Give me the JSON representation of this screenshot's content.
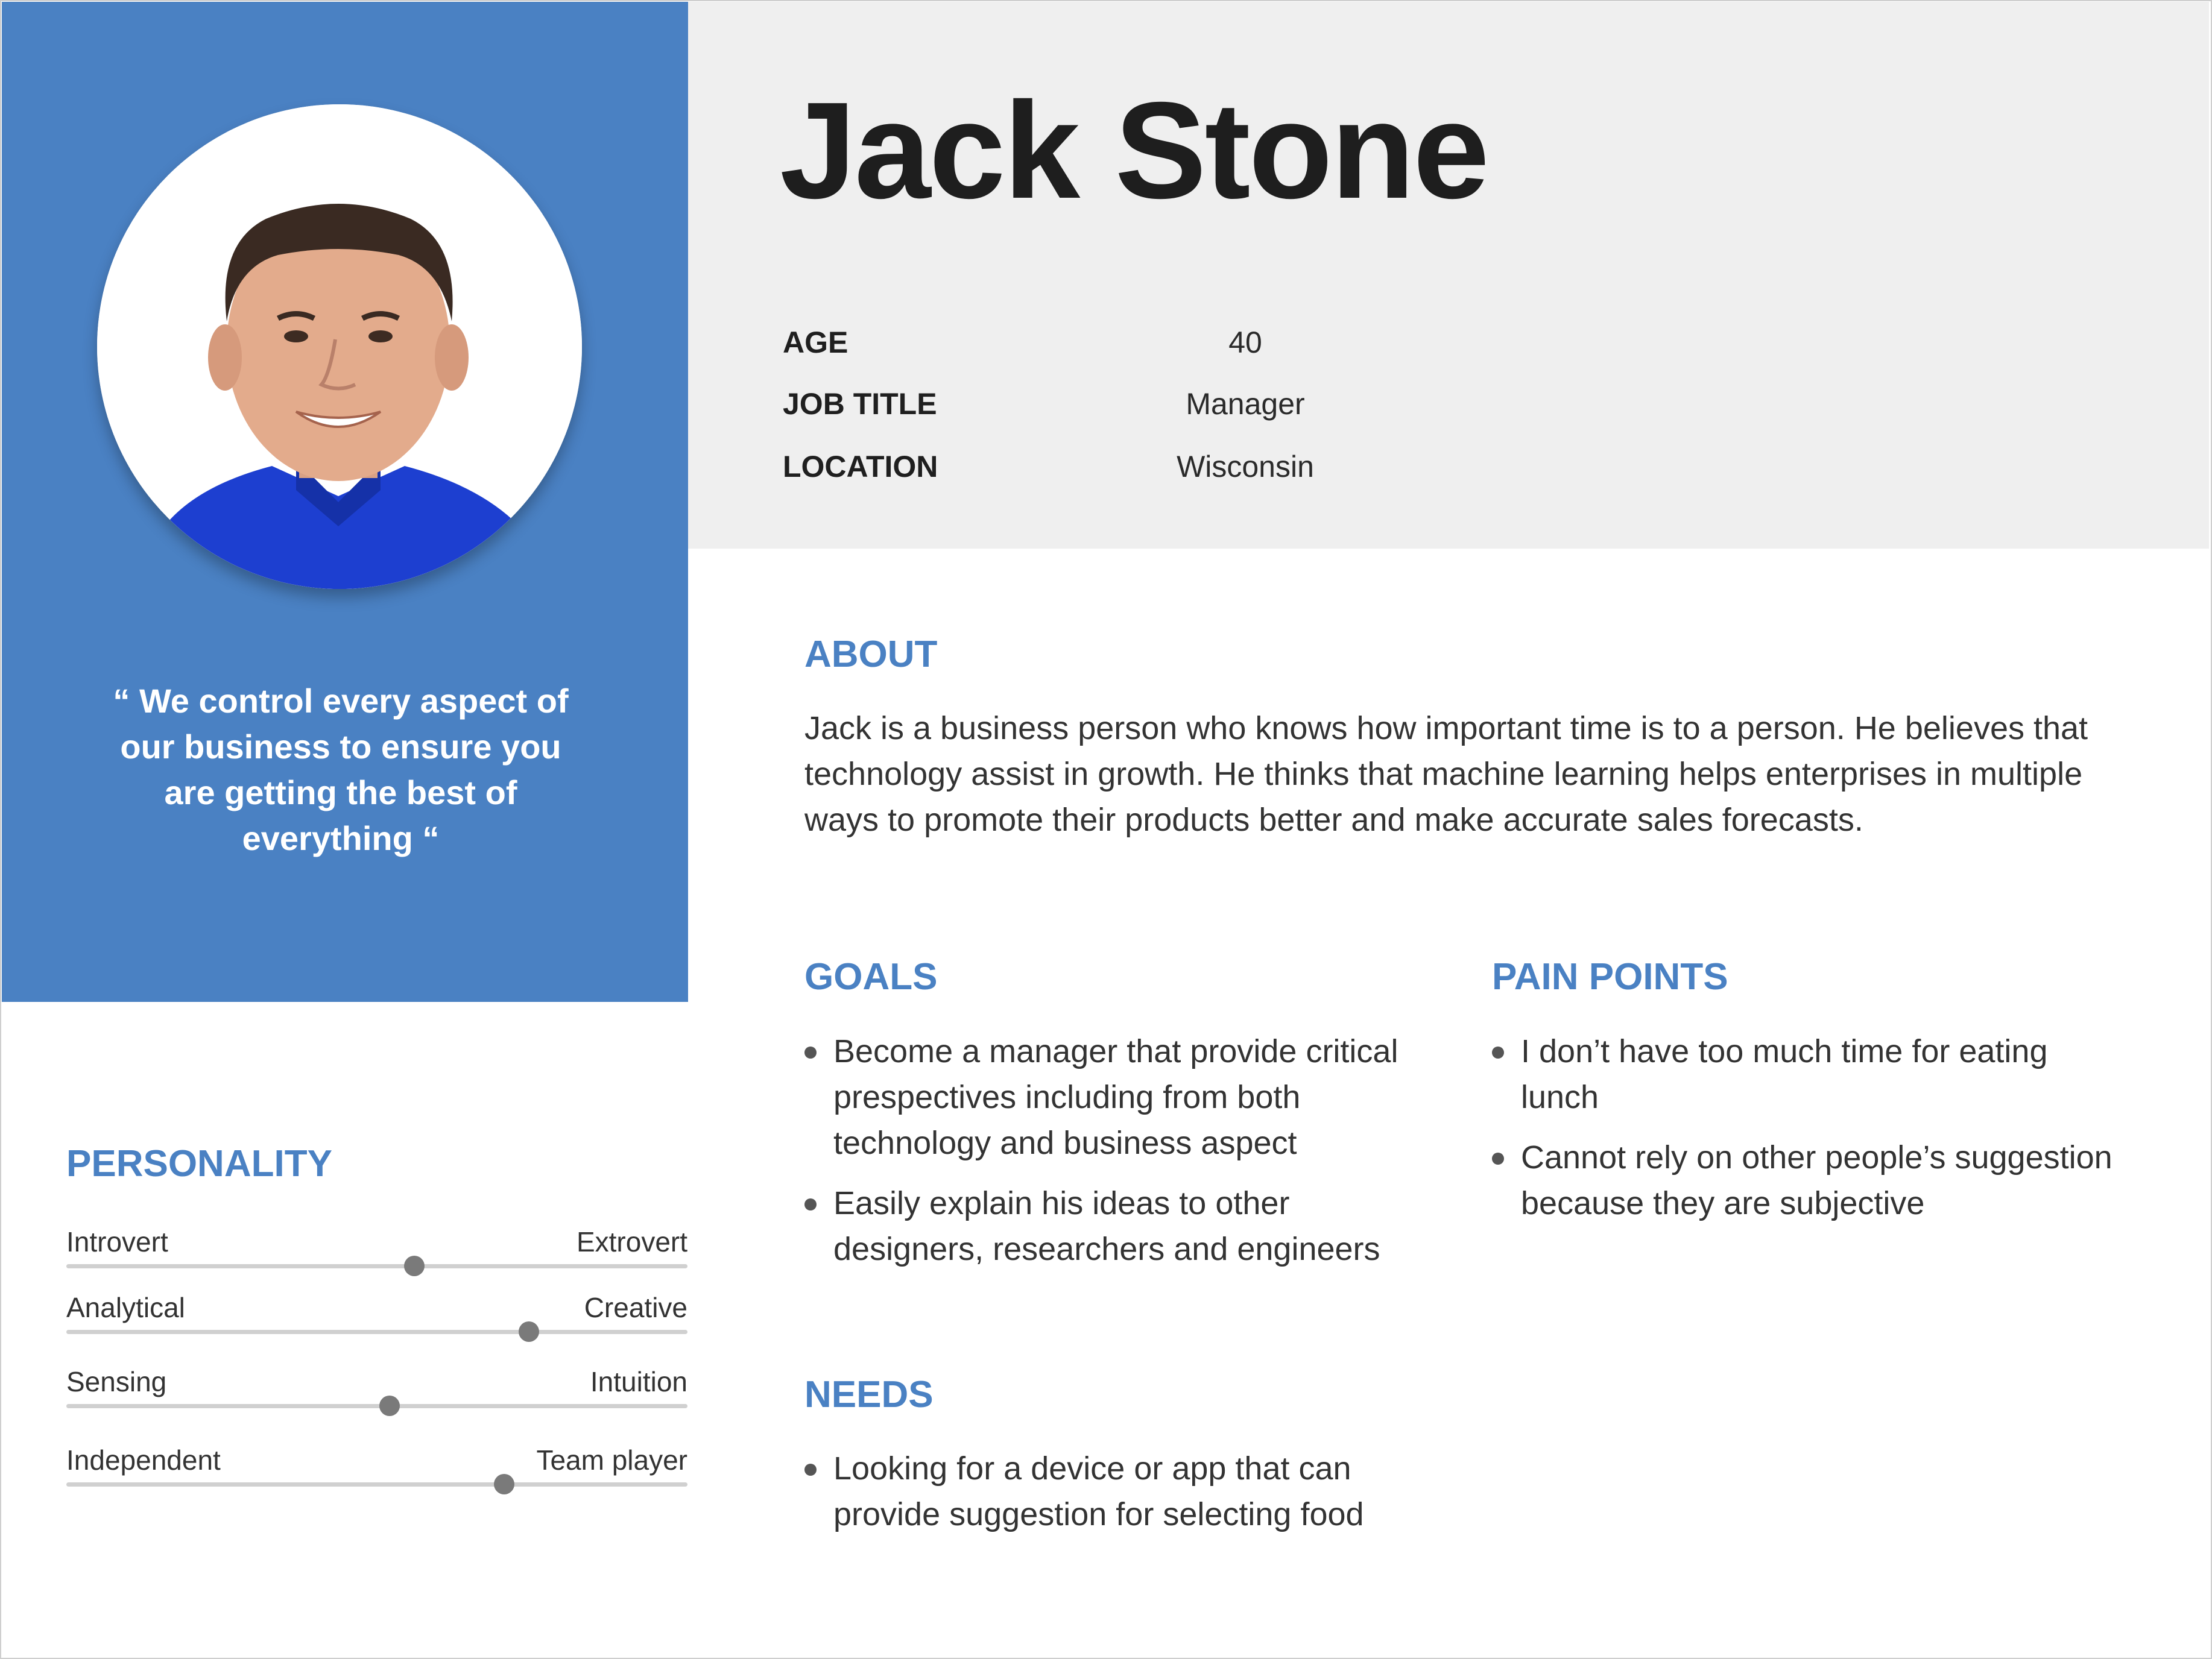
{
  "persona": {
    "name": "Jack Stone",
    "quote": "“ We control every aspect of our business to ensure you are getting the best of everything “"
  },
  "details": {
    "age": {
      "label": "AGE",
      "value": "40"
    },
    "job_title": {
      "label": "JOB TITLE",
      "value": "Manager"
    },
    "location": {
      "label": "LOCATION",
      "value": "Wisconsin"
    }
  },
  "about": {
    "title": "ABOUT",
    "text": "Jack is a business person who knows how important time is to a person. He believes that technology assist in growth. He thinks that machine learning helps enterprises in multiple ways to promote their products better and make accurate sales forecasts."
  },
  "goals": {
    "title": "GOALS",
    "items": [
      "Become a manager that provide critical prespectives including from both technology and business aspect",
      "Easily explain his ideas to other designers, researchers and engineers"
    ]
  },
  "pain_points": {
    "title": "PAIN POINTS",
    "items": [
      "I don’t have too much time for eating lunch",
      "Cannot rely on other people’s suggestion because they are subjective"
    ]
  },
  "needs": {
    "title": "NEEDS",
    "items": [
      "Looking for a device or app that can provide suggestion for selecting food"
    ]
  },
  "personality": {
    "title": "PERSONALITY",
    "traits": [
      {
        "left": "Introvert",
        "right": "Extrovert",
        "level": 0.56
      },
      {
        "left": "Analytical",
        "right": "Creative",
        "level": 0.745
      },
      {
        "left": "Sensing",
        "right": "Intuition",
        "level": 0.52
      },
      {
        "left": "Independent",
        "right": "Team player",
        "level": 0.705
      }
    ]
  },
  "colors": {
    "accent": "#4a81c3",
    "header_bg": "#efefef",
    "shirt": "#1d3fd0",
    "slider_knob": "#7a7a7a"
  }
}
